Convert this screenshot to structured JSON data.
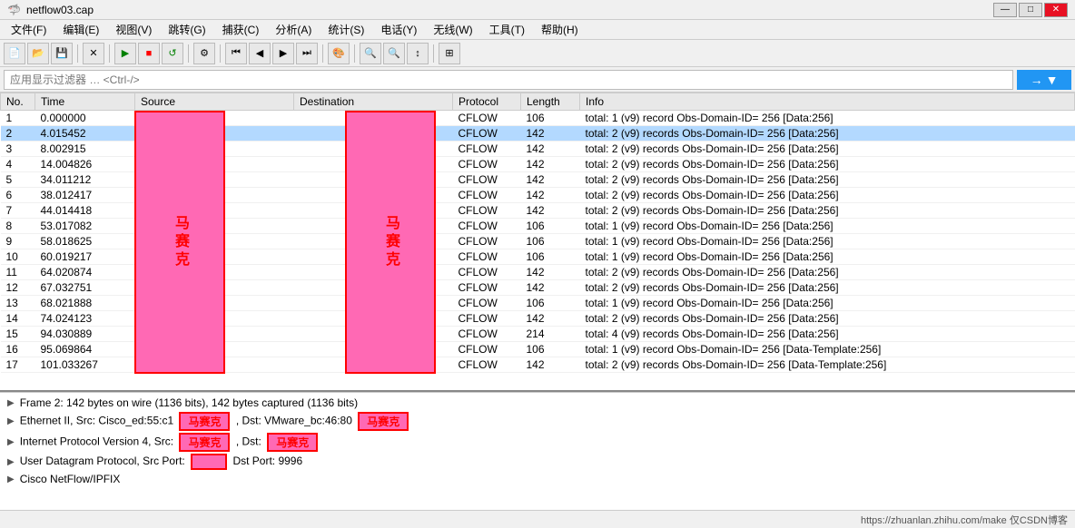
{
  "titlebar": {
    "title": "netflow03.cap",
    "controls": [
      "—",
      "□",
      "✕"
    ]
  },
  "menubar": {
    "items": [
      {
        "label": "文件(F)"
      },
      {
        "label": "编辑(E)"
      },
      {
        "label": "视图(V)"
      },
      {
        "label": "跳转(G)"
      },
      {
        "label": "捕获(C)"
      },
      {
        "label": "分析(A)"
      },
      {
        "label": "统计(S)"
      },
      {
        "label": "电话(Y)"
      },
      {
        "label": "无线(W)"
      },
      {
        "label": "工具(T)"
      },
      {
        "label": "帮助(H)"
      }
    ]
  },
  "filter": {
    "placeholder": "应用显示过滤器 … <Ctrl-/>",
    "value": ""
  },
  "table": {
    "headers": [
      "No.",
      "Time",
      "Source",
      "Destination",
      "Protocol",
      "Length",
      "Info"
    ],
    "rows": [
      {
        "no": "1",
        "time": "0.000000",
        "source": "",
        "dest": "",
        "proto": "CFLOW",
        "len": "106",
        "info": "total: 1 (v9) record Obs-Domain-ID= 256 [Data:256]"
      },
      {
        "no": "2",
        "time": "4.015452",
        "source": "",
        "dest": "",
        "proto": "CFLOW",
        "len": "142",
        "info": "total: 2 (v9) records Obs-Domain-ID= 256 [Data:256]",
        "selected": true
      },
      {
        "no": "3",
        "time": "8.002915",
        "source": "",
        "dest": "",
        "proto": "CFLOW",
        "len": "142",
        "info": "total: 2 (v9) records Obs-Domain-ID= 256 [Data:256]"
      },
      {
        "no": "4",
        "time": "14.004826",
        "source": "",
        "dest": "",
        "proto": "CFLOW",
        "len": "142",
        "info": "total: 2 (v9) records Obs-Domain-ID= 256 [Data:256]"
      },
      {
        "no": "5",
        "time": "34.011212",
        "source": "",
        "dest": "",
        "proto": "CFLOW",
        "len": "142",
        "info": "total: 2 (v9) records Obs-Domain-ID= 256 [Data:256]"
      },
      {
        "no": "6",
        "time": "38.012417",
        "source": "",
        "dest": "",
        "proto": "CFLOW",
        "len": "142",
        "info": "total: 2 (v9) records Obs-Domain-ID= 256 [Data:256]"
      },
      {
        "no": "7",
        "time": "44.014418",
        "source": "",
        "dest": "",
        "proto": "CFLOW",
        "len": "142",
        "info": "total: 2 (v9) records Obs-Domain-ID= 256 [Data:256]"
      },
      {
        "no": "8",
        "time": "53.017082",
        "source": "",
        "dest": "",
        "proto": "CFLOW",
        "len": "106",
        "info": "total: 1 (v9) record Obs-Domain-ID= 256 [Data:256]"
      },
      {
        "no": "9",
        "time": "58.018625",
        "source": "",
        "dest": "",
        "proto": "CFLOW",
        "len": "106",
        "info": "total: 1 (v9) record Obs-Domain-ID= 256 [Data:256]"
      },
      {
        "no": "10",
        "time": "60.019217",
        "source": "",
        "dest": "",
        "proto": "CFLOW",
        "len": "106",
        "info": "total: 1 (v9) record Obs-Domain-ID= 256 [Data:256]"
      },
      {
        "no": "11",
        "time": "64.020874",
        "source": "",
        "dest": "",
        "proto": "CFLOW",
        "len": "142",
        "info": "total: 2 (v9) records Obs-Domain-ID= 256 [Data:256]"
      },
      {
        "no": "12",
        "time": "67.032751",
        "source": "",
        "dest": "",
        "proto": "CFLOW",
        "len": "142",
        "info": "total: 2 (v9) records Obs-Domain-ID= 256 [Data:256]"
      },
      {
        "no": "13",
        "time": "68.021888",
        "source": "",
        "dest": "",
        "proto": "CFLOW",
        "len": "106",
        "info": "total: 1 (v9) record Obs-Domain-ID= 256 [Data:256]"
      },
      {
        "no": "14",
        "time": "74.024123",
        "source": "",
        "dest": "",
        "proto": "CFLOW",
        "len": "142",
        "info": "total: 2 (v9) records Obs-Domain-ID= 256 [Data:256]"
      },
      {
        "no": "15",
        "time": "94.030889",
        "source": "",
        "dest": "",
        "proto": "CFLOW",
        "len": "214",
        "info": "total: 4 (v9) records Obs-Domain-ID= 256 [Data:256]"
      },
      {
        "no": "16",
        "time": "95.069864",
        "source": "",
        "dest": "",
        "proto": "CFLOW",
        "len": "106",
        "info": "total: 1 (v9) record Obs-Domain-ID= 256 [Data-Template:256]"
      },
      {
        "no": "17",
        "time": "101.033267",
        "source": "",
        "dest": "",
        "proto": "CFLOW",
        "len": "142",
        "info": "total: 2 (v9) records Obs-Domain-ID= 256 [Data-Template:256]"
      }
    ]
  },
  "mosaic_label": "马赛克",
  "detail": {
    "frame_info": "Frame 2: 142 bytes on wire (1136 bits), 142 bytes captured (1136 bits)",
    "ethernet_label": "Ethernet",
    "ethernet_src_prefix": "Ethernet II, Src: Cisco_ed:55:c1",
    "ethernet_src_mosaic": "马赛克",
    "ethernet_dst_prefix": ", Dst: VMware_bc:46:80",
    "ethernet_dst_mosaic": "马赛克",
    "ip_prefix": "Internet Protocol Version 4, Src:",
    "ip_src_mosaic": "马赛克",
    "ip_dst_label": ", Dst:",
    "ip_dst_mosaic": "马赛克",
    "udp_prefix": "User Datagram Protocol, Src Port:",
    "udp_dst": "Dst Port: 9996",
    "cisco_label": "Cisco NetFlow/IPFIX"
  },
  "statusbar": {
    "text": "https://zhuanlan.zhihu.com/make 仅CSDN博客"
  },
  "colors": {
    "selected_row": "#b3d9ff",
    "mosaic_bg": "#ff69b4",
    "mosaic_border": "#ff0000",
    "header_bg": "#e8e8e8"
  }
}
